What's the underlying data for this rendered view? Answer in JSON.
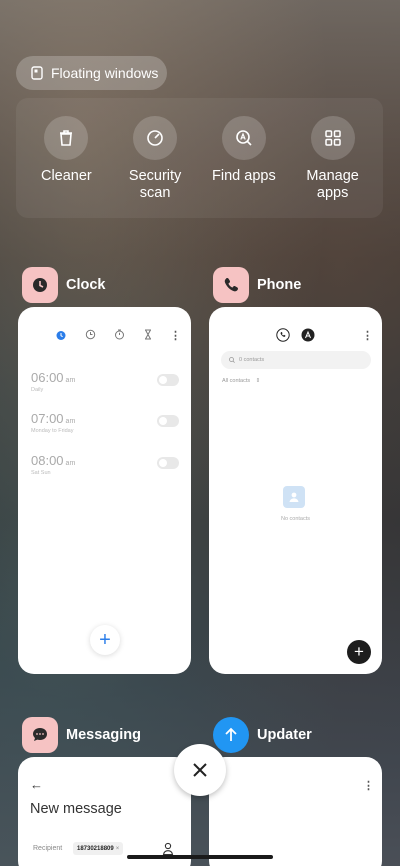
{
  "floating_windows": {
    "label": "Floating windows"
  },
  "tools": [
    {
      "label": "Cleaner",
      "icon": "trash-icon"
    },
    {
      "label": "Security\nscan",
      "icon": "gauge-icon"
    },
    {
      "label": "Find apps",
      "icon": "app-search-icon"
    },
    {
      "label": "Manage\napps",
      "icon": "grid-icon"
    }
  ],
  "apps": {
    "clock": {
      "name": "Clock",
      "icon_color": "#f6c3c3",
      "alarms": [
        {
          "time": "06:00",
          "suffix": "am",
          "repeat": "Daily"
        },
        {
          "time": "07:00",
          "suffix": "am",
          "repeat": "Monday to Friday"
        },
        {
          "time": "08:00",
          "suffix": "am",
          "repeat": "Sat Sun"
        }
      ],
      "tab_icons": [
        "alarm-icon",
        "world-clock-icon",
        "stopwatch-icon",
        "timer-icon",
        "more-icon"
      ],
      "add": "+"
    },
    "phone": {
      "name": "Phone",
      "icon_color": "#f6c3c3",
      "search_placeholder": "0 contacts",
      "filter_label": "All contacts",
      "empty_text": "No contacts",
      "add": "+"
    },
    "messaging": {
      "name": "Messaging",
      "icon_color": "#f6c3c3",
      "back": "←",
      "title": "New message",
      "recipient_label": "Recipient",
      "recipient_value": "18730218809"
    },
    "updater": {
      "name": "Updater",
      "icon_color": "#2196f3",
      "more": "⋮"
    }
  },
  "close": {
    "symbol": "✕"
  }
}
